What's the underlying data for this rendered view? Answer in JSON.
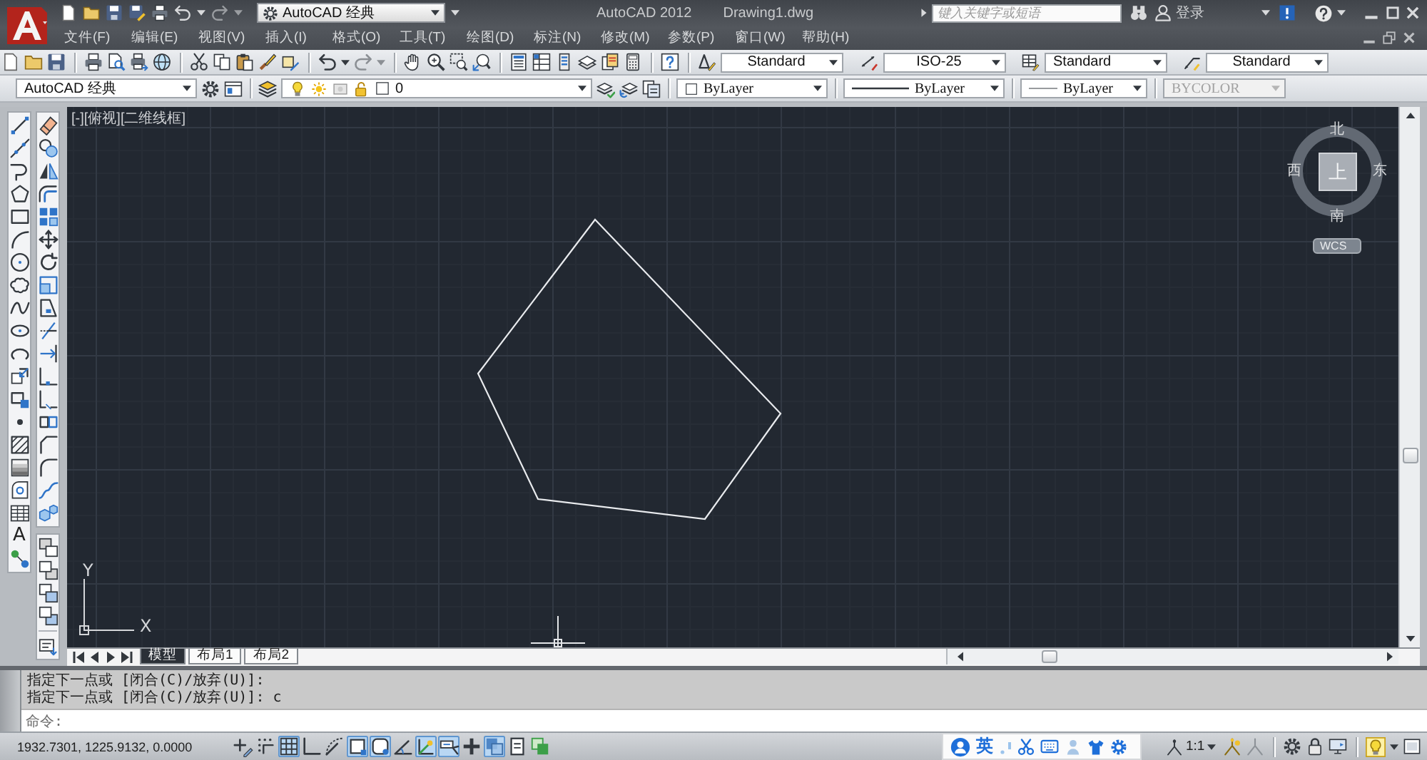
{
  "title_bar": {
    "workspace": "AutoCAD 经典",
    "app_title": "AutoCAD 2012",
    "document_title": "Drawing1.dwg",
    "search": {
      "placeholder": "键入关键字或短语"
    },
    "sign_in": "登录"
  },
  "menu_bar": [
    "文件(F)",
    "编辑(E)",
    "视图(V)",
    "插入(I)",
    "格式(O)",
    "工具(T)",
    "绘图(D)",
    "标注(N)",
    "修改(M)",
    "参数(P)",
    "窗口(W)",
    "帮助(H)"
  ],
  "styles_toolbar": {
    "text_style": "Standard",
    "dimension_style": "ISO-25",
    "table_style": "Standard",
    "multileader_style": "Standard"
  },
  "layers_toolbar": {
    "workspace": "AutoCAD 经典",
    "layer": "0"
  },
  "properties_toolbar": [
    {
      "kind": "swatch",
      "value": "ByLayer",
      "disabled": false
    },
    {
      "kind": "linetype",
      "value": "ByLayer",
      "disabled": false
    },
    {
      "kind": "lineweight",
      "value": "ByLayer",
      "disabled": false
    },
    {
      "kind": "plot_style",
      "value": "BYCOLOR",
      "disabled": true
    }
  ],
  "draw_toolbar": {
    "text_tool": "A"
  },
  "viewport": {
    "controls": [
      "[-]",
      "[俯视]",
      "[二维线框]"
    ],
    "viewcube": {
      "north": "北",
      "west": "西",
      "top": "上",
      "east": "东",
      "south": "南",
      "ucs": "WCS"
    },
    "ucs_icon": {
      "y": "Y",
      "x": "X"
    }
  },
  "layout_tabs": [
    {
      "label": "模型",
      "selected": true
    },
    {
      "label": "布局1",
      "selected": false
    },
    {
      "label": "布局2",
      "selected": false
    }
  ],
  "command_line": {
    "history": [
      "指定下一点或 [闭合(C)/放弃(U)]:",
      "指定下一点或 [闭合(C)/放弃(U)]: c"
    ],
    "prompt": "命令:"
  },
  "status_bar": {
    "coordinates": "1932.7301, 1225.9132, 0.0000",
    "toggles": [
      {
        "kind": "infer",
        "on": false
      },
      {
        "kind": "snap",
        "on": false
      },
      {
        "kind": "grid",
        "on": true
      },
      {
        "kind": "ortho",
        "on": false
      },
      {
        "kind": "polar",
        "on": false
      },
      {
        "kind": "osnap",
        "on": true
      },
      {
        "kind": "osnap3d",
        "on": true
      },
      {
        "kind": "otrack",
        "on": false
      },
      {
        "kind": "ducs",
        "on": true
      },
      {
        "kind": "dyn",
        "on": true
      },
      {
        "kind": "lweight",
        "on": false
      },
      {
        "kind": "transparency",
        "on": true
      },
      {
        "kind": "qp",
        "on": false
      },
      {
        "kind": "cycling",
        "on": false
      }
    ],
    "input_method": "英",
    "annotation_scale": "1:1"
  }
}
